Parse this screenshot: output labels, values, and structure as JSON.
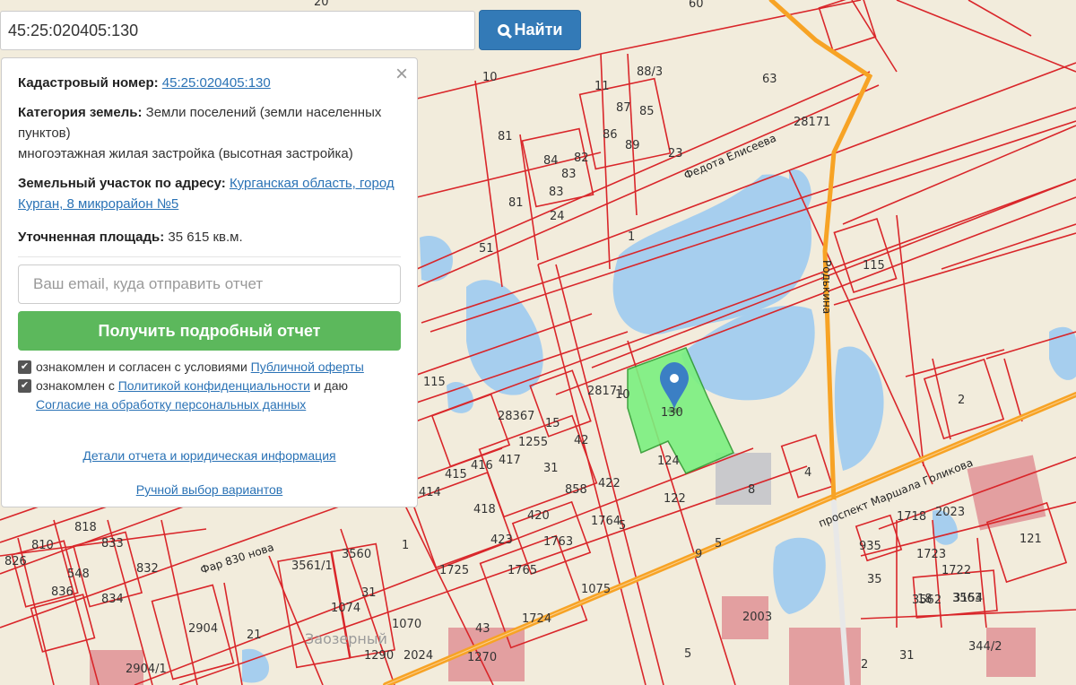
{
  "search": {
    "value": "45:25:020405:130",
    "button_label": "Найти"
  },
  "panel": {
    "close_label": "×",
    "cadastral_label": "Кадастровый номер:",
    "cadastral_value": "45:25:020405:130",
    "category_label": "Категория земель:",
    "category_value": "Земли поселений (земли населенных пунктов)",
    "category_use": "многоэтажная жилая застройка (высотная застройка)",
    "address_label": "Земельный участок по адресу:",
    "address_value": "Курганская область, город Курган, 8 микрорайон №5",
    "area_label": "Уточненная площадь:",
    "area_value": "35 615 кв.м.",
    "email_placeholder": "Ваш email, куда отправить отчет",
    "cta_label": "Получить подробный отчет",
    "agree1_text": "ознакомлен и согласен с условиями",
    "agree1_link": "Публичной оферты",
    "agree2_text": "ознакомлен с",
    "agree2_link": "Политикой конфиденциальности",
    "agree2_tail": "и даю",
    "agree2_link2": "Согласие на обработку персональных данных",
    "details_link": "Детали отчета и юридическая информация",
    "manual_link": "Ручной выбор вариантов"
  },
  "map": {
    "colors": {
      "background": "#f2ecdc",
      "water": "#a6ceee",
      "parcel_line": "#d9262a",
      "road": "#f7a325",
      "highlight": "#7bf07f",
      "marker": "#3b7fc4"
    },
    "selected_parcel_label": "130",
    "streets": [
      "Федота Елисеева",
      "Родькина",
      "проспект Маршала Голикова",
      "Фар 830 нова"
    ],
    "parcel_labels": [
      "20",
      "60",
      "10",
      "88/3",
      "63",
      "11",
      "87",
      "85",
      "81",
      "86",
      "89",
      "28171",
      "23",
      "84",
      "83",
      "82",
      "83",
      "81",
      "24",
      "1",
      "51",
      "115",
      "10",
      "28171",
      "28367",
      "115",
      "15",
      "1255",
      "42",
      "2",
      "124",
      "416",
      "415",
      "417",
      "31",
      "858",
      "422",
      "8",
      "414",
      "4",
      "122",
      "418",
      "420",
      "1763",
      "5",
      "423",
      "1764",
      "2023",
      "121",
      "818",
      "810",
      "833",
      "832",
      "1",
      "9",
      "5",
      "1718",
      "935",
      "826",
      "548",
      "836",
      "834",
      "1765",
      "1075",
      "1723",
      "1722",
      "3562",
      "3563",
      "3561/1",
      "3560",
      "31",
      "1074",
      "1725",
      "1724",
      "18",
      "3154",
      "2003",
      "21",
      "2904",
      "2904/1",
      "1290",
      "1070",
      "2024",
      "43",
      "35",
      "1270",
      "2",
      "31",
      "344/2",
      "5"
    ],
    "place_label": "Заозерный"
  }
}
